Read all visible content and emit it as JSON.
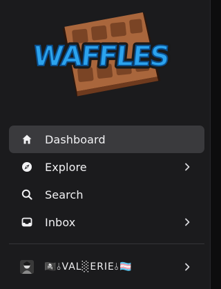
{
  "logo": {
    "text": "WAFFLES"
  },
  "nav": {
    "items": [
      {
        "label": "Dashboard",
        "icon": "home-icon",
        "active": true,
        "has_chevron": false
      },
      {
        "label": "Explore",
        "icon": "compass-icon",
        "active": false,
        "has_chevron": true
      },
      {
        "label": "Search",
        "icon": "search-icon",
        "active": false,
        "has_chevron": false
      },
      {
        "label": "Inbox",
        "icon": "inbox-icon",
        "active": false,
        "has_chevron": true
      }
    ]
  },
  "user": {
    "name": "🏴‍☠️⫰VAL░ERIE⫰🏳️‍⚧️",
    "avatar_icon": "user-avatar"
  },
  "colors": {
    "sidebar_bg": "#1b1b1d",
    "active_bg": "#3a3a3d",
    "logo_blue": "#2aa8f0",
    "waffle_brown": "#a0603a"
  }
}
